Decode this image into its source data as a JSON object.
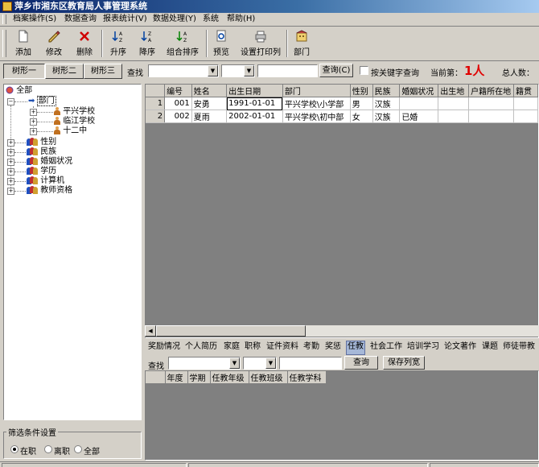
{
  "window": {
    "title": "萍乡市湘东区教育局人事管理系统"
  },
  "menu": [
    "档案操作(S)",
    "数据查询",
    "报表统计(V)",
    "数据处理(Y)",
    "系统",
    "帮助(H)"
  ],
  "toolbar": [
    "添加",
    "修改",
    "删除",
    "升序",
    "降序",
    "组合排序",
    "预览",
    "设置打印列",
    "部门"
  ],
  "tabs": [
    "树形一",
    "树形二",
    "树形三"
  ],
  "search": {
    "label": "查找",
    "button": "查询(C)",
    "keyword_checkbox": "按关键字查询",
    "current_label": "当前第：",
    "current_value": "1人",
    "total_label": "总人数："
  },
  "tree": {
    "root": "全部",
    "dept": "部门",
    "schools": [
      "平兴学校",
      "临江学校",
      "十二中"
    ],
    "categories": [
      "性别",
      "民族",
      "婚姻状况",
      "学历",
      "计算机",
      "教师资格"
    ]
  },
  "grid": {
    "columns": [
      "编号",
      "姓名",
      "出生日期",
      "部门",
      "性别",
      "民族",
      "婚姻状况",
      "出生地",
      "户籍所在地",
      "籍贯"
    ],
    "rows": [
      {
        "n": "1",
        "id": "001",
        "name": "安勇",
        "birth": "1991-01-01",
        "dept": "平兴学校\\小学部",
        "sex": "男",
        "nation": "汉族",
        "marriage": ""
      },
      {
        "n": "2",
        "id": "002",
        "name": "夏雨",
        "birth": "2002-01-01",
        "dept": "平兴学校\\初中部",
        "sex": "女",
        "nation": "汉族",
        "marriage": "已婚"
      }
    ]
  },
  "subtabs": [
    "奖励情况",
    "个人简历",
    "家庭",
    "职称",
    "证件资料",
    "考勤",
    "奖惩",
    "任教",
    "社会工作",
    "培训学习",
    "论文著作",
    "课题",
    "师徒带教"
  ],
  "subfilter": {
    "label": "查找",
    "query_button": "查询",
    "save_button": "保存列宽"
  },
  "subgrid": {
    "columns": [
      "年度",
      "学期",
      "任教年级",
      "任教班级",
      "任教学科"
    ]
  },
  "filter_settings": {
    "title": "筛选条件设置",
    "options": [
      "在职",
      "离职",
      "全部"
    ]
  },
  "accent_colors": {
    "title_start": "#0a246a",
    "title_end": "#a6caf0",
    "current_value": "#e00000"
  }
}
